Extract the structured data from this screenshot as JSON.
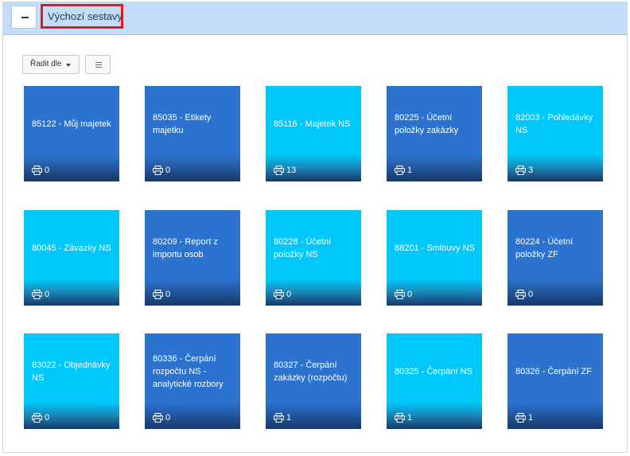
{
  "header": {
    "collapse_symbol": "—",
    "title": "Výchozí sestavy"
  },
  "toolbar": {
    "sort_label": "Řadit dle",
    "list_view_icon": "list-icon"
  },
  "colors": {
    "header_bg": "#c3dcf7",
    "tile_dark": "#2c73cf",
    "tile_light": "#00c8fa",
    "highlight_border": "#e01b1b"
  },
  "tiles": [
    {
      "label": "85122 - Můj majetek",
      "count": "0",
      "style": "dark"
    },
    {
      "label": "85035 - Etikety majetku",
      "count": "0",
      "style": "dark"
    },
    {
      "label": "85116 - Majetek NS",
      "count": "13",
      "style": "light"
    },
    {
      "label": "80225 - Účetní položky zakázky",
      "count": "1",
      "style": "dark"
    },
    {
      "label": "82003 - Pohledávky NS",
      "count": "3",
      "style": "light"
    },
    {
      "label": "80045 - Závazky NS",
      "count": "0",
      "style": "light"
    },
    {
      "label": "80209 - Report z importu osob",
      "count": "0",
      "style": "dark"
    },
    {
      "label": "80228 - Účetní položky NS",
      "count": "0",
      "style": "light"
    },
    {
      "label": "88201 - Smlouvy NS",
      "count": "0",
      "style": "light"
    },
    {
      "label": "80224 - Účetní položky ZF",
      "count": "0",
      "style": "dark"
    },
    {
      "label": "83022 - Objednávky NS",
      "count": "0",
      "style": "light"
    },
    {
      "label": "80336 - Čerpání rozpočtu NS - analytické rozbory",
      "count": "0",
      "style": "dark"
    },
    {
      "label": "80327 - Čerpání zakázky (rozpočtu)",
      "count": "1",
      "style": "dark"
    },
    {
      "label": "80325 - Čerpání NS",
      "count": "1",
      "style": "light"
    },
    {
      "label": "80326 - Čerpání ZF",
      "count": "1",
      "style": "dark"
    }
  ]
}
